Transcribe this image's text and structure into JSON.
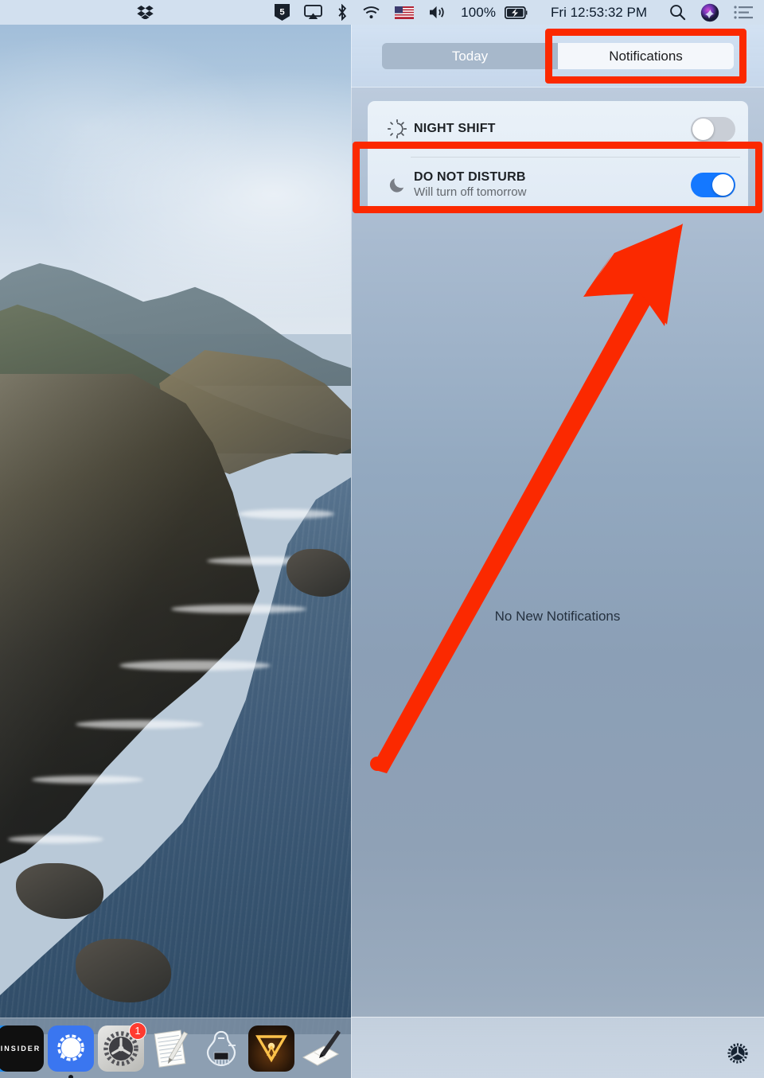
{
  "menubar": {
    "icons": [
      {
        "name": "dropbox-icon",
        "glyph": "dropbox"
      },
      {
        "name": "html5-shield-icon",
        "glyph": "shield5"
      },
      {
        "name": "airplay-icon",
        "glyph": "airplay"
      },
      {
        "name": "bluetooth-icon",
        "glyph": "bluetooth"
      },
      {
        "name": "wifi-icon",
        "glyph": "wifi"
      },
      {
        "name": "input-flag-icon",
        "glyph": "usflag"
      },
      {
        "name": "volume-icon",
        "glyph": "speaker"
      }
    ],
    "battery_percent": "100%",
    "battery_icon": "battery-charging-icon",
    "clock": "Fri 12:53:32 PM",
    "search_icon": "search-icon",
    "siri_icon": "siri-icon",
    "notification_center_icon": "notification-center-icon"
  },
  "notification_center": {
    "tabs": [
      {
        "label": "Today",
        "active": false
      },
      {
        "label": "Notifications",
        "active": true
      }
    ],
    "toggles": [
      {
        "id": "night-shift",
        "title": "NIGHT SHIFT",
        "subtitle": "",
        "icon": "sun-icon",
        "state": "off",
        "state_label": "Off"
      },
      {
        "id": "do-not-disturb",
        "title": "DO NOT DISTURB",
        "subtitle": "Will turn off tomorrow",
        "icon": "moon-icon",
        "state": "on",
        "state_label": "On"
      }
    ],
    "empty_message": "No New Notifications",
    "footer_icon": "gear-icon"
  },
  "annotations": {
    "highlight_color": "#fb2900",
    "boxes": [
      {
        "name": "highlight-notifications-tab",
        "target": "Notifications"
      },
      {
        "name": "highlight-do-not-disturb-row",
        "target": "DO NOT DISTURB"
      }
    ],
    "arrow": {
      "name": "pointer-arrow",
      "color": "#fb2900",
      "from": "472,962",
      "to": "855,283"
    }
  },
  "dock": {
    "apps": [
      {
        "name": "dock-app-partial",
        "label": "",
        "badge": "",
        "running": false
      },
      {
        "name": "dock-app-insider",
        "label": "INSIDER",
        "badge": "",
        "running": false
      },
      {
        "name": "dock-app-signal",
        "label": "Signal",
        "badge": "",
        "running": true
      },
      {
        "name": "dock-app-system-preferences",
        "label": "System Preferences",
        "badge": "1",
        "running": false
      },
      {
        "name": "dock-app-notes",
        "label": "Notes",
        "badge": "",
        "running": false
      },
      {
        "name": "dock-app-circuit",
        "label": "Circuit",
        "badge": "",
        "running": false
      },
      {
        "name": "dock-app-vr",
        "label": "VR App",
        "badge": "",
        "running": false
      },
      {
        "name": "dock-app-sketch",
        "label": "Sketch",
        "badge": "",
        "running": false
      }
    ]
  },
  "colors": {
    "accent_blue": "#1478ff",
    "highlight_red": "#fb2900",
    "menubar_bg": "#d2e0ef",
    "badge_red": "#ff3b30"
  }
}
